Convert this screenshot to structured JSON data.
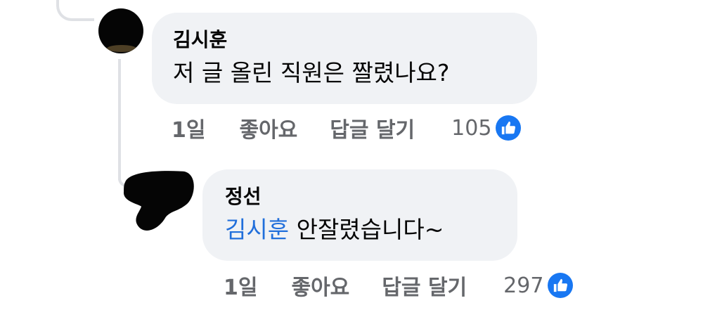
{
  "comment": {
    "author": "김시훈",
    "text": "저 글 올린 직원은 짤렸나요?",
    "time": "1일",
    "like_label": "좋아요",
    "reply_label": "답글 달기",
    "reaction_count": "105"
  },
  "reply": {
    "author": "정선",
    "mention": "김시훈",
    "text": " 안잘렸습니다~",
    "time": "1일",
    "like_label": "좋아요",
    "reply_label": "답글 달기",
    "reaction_count": "297"
  },
  "colors": {
    "bubble_bg": "#f0f2f5",
    "mention": "#216fdb",
    "meta_text": "#65676b",
    "like_blue": "#1877f2"
  },
  "icons": [
    "thumbs-up-icon"
  ]
}
